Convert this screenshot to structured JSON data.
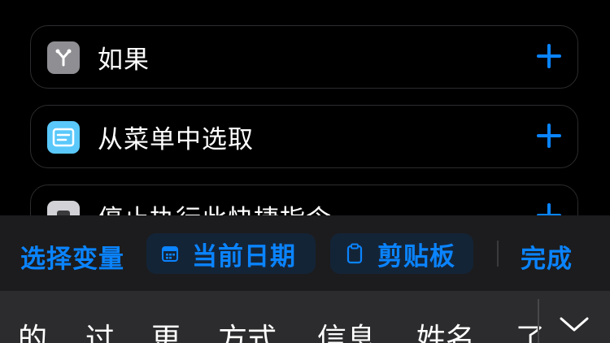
{
  "actions": [
    {
      "label": "如果",
      "icon": "branch-icon",
      "icon_bg": "#8e8e93"
    },
    {
      "label": "从菜单中选取",
      "icon": "menu-list-icon",
      "icon_bg": "#5ac8fa"
    },
    {
      "label": "停止执行此快捷指令",
      "icon": "stop-icon",
      "icon_bg": "#d1d1d6"
    }
  ],
  "variable_bar": {
    "select_variable": "选择变量",
    "current_date": "当前日期",
    "clipboard": "剪贴板",
    "done": "完成"
  },
  "keyboard": {
    "candidates": [
      "的",
      "过",
      "更",
      "方式",
      "信息",
      "姓名",
      "了"
    ]
  },
  "colors": {
    "accent": "#0a84ff",
    "background": "#000000",
    "bar": "#1c1c1e",
    "keyboard": "#2c2c2e"
  }
}
